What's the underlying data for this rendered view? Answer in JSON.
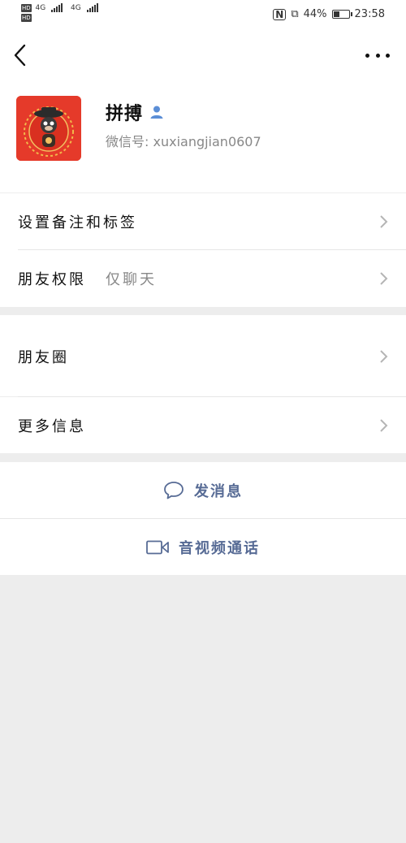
{
  "status_bar": {
    "left_badges": [
      "HD",
      "HD"
    ],
    "network": [
      "4G",
      "4G"
    ],
    "battery_text": "44%",
    "battery_level": 0.44,
    "time": "23:58",
    "right_icons": [
      "nfc-icon",
      "vibrate-icon",
      "battery-icon"
    ]
  },
  "nav": {
    "back_icon": "chevron-left-icon",
    "more_icon": "more-dots-icon"
  },
  "profile": {
    "name": "拼搏",
    "wechat_id_label": "微信号: ",
    "wechat_id": "xuxiangjian0607",
    "avatar_bg": "#e53a2a",
    "person_icon_color": "#5b8ed6"
  },
  "settings_rows": [
    {
      "label": "设置备注和标签",
      "value": ""
    },
    {
      "label": "朋友权限",
      "value": "仅聊天"
    },
    {
      "label": "朋友圈",
      "value": ""
    },
    {
      "label": "更多信息",
      "value": ""
    }
  ],
  "actions": {
    "message_label": "发消息",
    "call_label": "音视频通话",
    "action_color": "#576b95"
  }
}
